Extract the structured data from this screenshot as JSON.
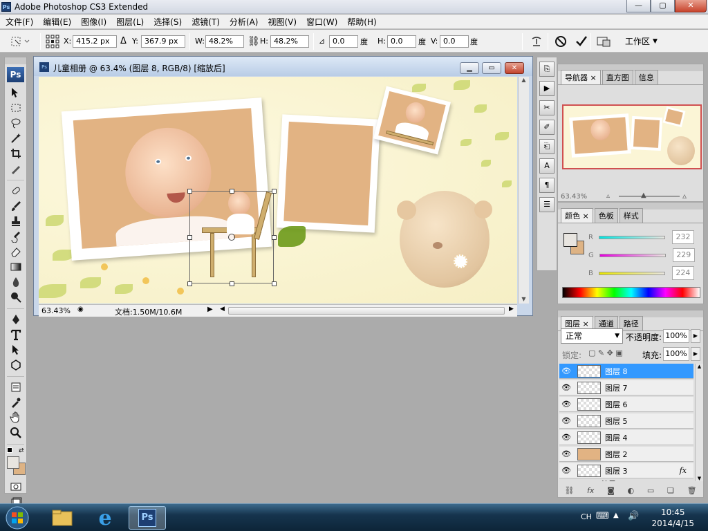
{
  "window": {
    "title": "Adobe Photoshop CS3 Extended",
    "logo": "Ps",
    "min_label": "—",
    "max_label": "▢",
    "close_label": "✕"
  },
  "menu": [
    "文件(F)",
    "编辑(E)",
    "图像(I)",
    "图层(L)",
    "选择(S)",
    "滤镜(T)",
    "分析(A)",
    "视图(V)",
    "窗口(W)",
    "帮助(H)"
  ],
  "options": {
    "x_label": "X:",
    "x_value": "415.2 px",
    "y_label": "Y:",
    "y_value": "367.9 px",
    "w_label": "W:",
    "w_value": "48.2%",
    "h_label": "H:",
    "h_value": "48.2%",
    "rot_value": "0.0",
    "deg1": "度",
    "hskew_label": "H:",
    "hskew_value": "0.0",
    "deg2": "度",
    "vskew_label": "V:",
    "vskew_value": "0.0",
    "deg3": "度",
    "workspace_label": "工作区"
  },
  "toolbox": {
    "badge": "Ps"
  },
  "document": {
    "title": "儿童相册 @ 63.4% (图层 8, RGB/8) [缩放后]",
    "zoom": "63.43%",
    "doc_info": "文档:1.50M/10.6M"
  },
  "navigator": {
    "tabs": [
      "导航器",
      "直方图",
      "信息"
    ],
    "zoom": "63.43%"
  },
  "color": {
    "tabs": [
      "颜色",
      "色板",
      "样式"
    ],
    "r_label": "R",
    "r_value": "232",
    "g_label": "G",
    "g_value": "229",
    "b_label": "B",
    "b_value": "224",
    "foreground": "#e8e5e0",
    "background": "#deb384"
  },
  "layers": {
    "tabs": [
      "图层",
      "通道",
      "路径"
    ],
    "blend_mode": "正常",
    "opacity_label": "不透明度:",
    "opacity_value": "100%",
    "lock_label": "锁定:",
    "fill_label": "填充:",
    "fill_value": "100%",
    "items": [
      {
        "name": "图层 8",
        "selected": true
      },
      {
        "name": "图层 7",
        "selected": false
      },
      {
        "name": "图层 6",
        "selected": false
      },
      {
        "name": "图层 5",
        "selected": false
      },
      {
        "name": "图层 4",
        "selected": false
      },
      {
        "name": "图层 2",
        "selected": false
      },
      {
        "name": "图层 3",
        "selected": false,
        "fx": "fx"
      }
    ],
    "partial_item": "效果"
  },
  "taskbar": {
    "lang": "CH",
    "time": "10:45",
    "date": "2014/4/15",
    "ps_label": "Ps"
  },
  "colors": {
    "accent": "#3399ff",
    "photo_fill": "#e2b383"
  }
}
